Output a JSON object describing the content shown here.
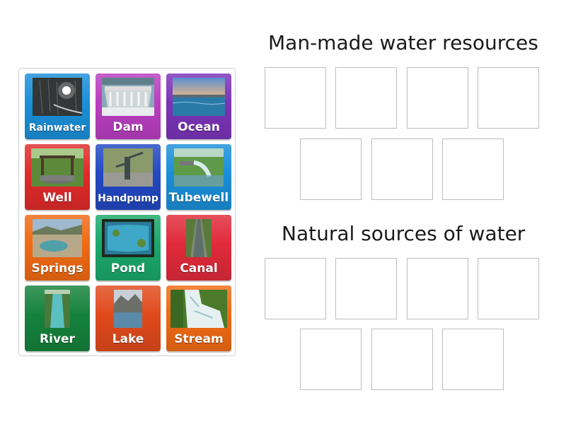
{
  "cards": [
    {
      "label": "Rainwater",
      "color": "#1a8fd8",
      "icon": "rain-photo"
    },
    {
      "label": "Dam",
      "color": "#b93ec0",
      "icon": "dam-photo"
    },
    {
      "label": "Ocean",
      "color": "#7b33b8",
      "icon": "ocean-photo"
    },
    {
      "label": "Well",
      "color": "#e02a2a",
      "icon": "well-photo"
    },
    {
      "label": "Handpump",
      "color": "#2248c2",
      "icon": "handpump-photo"
    },
    {
      "label": "Tubewell",
      "color": "#1a8fd8",
      "icon": "tubewell-photo"
    },
    {
      "label": "Springs",
      "color": "#f06a14",
      "icon": "springs-photo"
    },
    {
      "label": "Pond",
      "color": "#1aa86a",
      "icon": "pond-photo"
    },
    {
      "label": "Canal",
      "color": "#e02a3a",
      "icon": "canal-photo"
    },
    {
      "label": "River",
      "color": "#15823c",
      "icon": "river-photo"
    },
    {
      "label": "Lake",
      "color": "#e04a1c",
      "icon": "lake-photo"
    },
    {
      "label": "Stream",
      "color": "#f06a14",
      "icon": "stream-photo"
    }
  ],
  "groups": [
    {
      "title": "Man-made water resources"
    },
    {
      "title": "Natural sources of water"
    }
  ]
}
